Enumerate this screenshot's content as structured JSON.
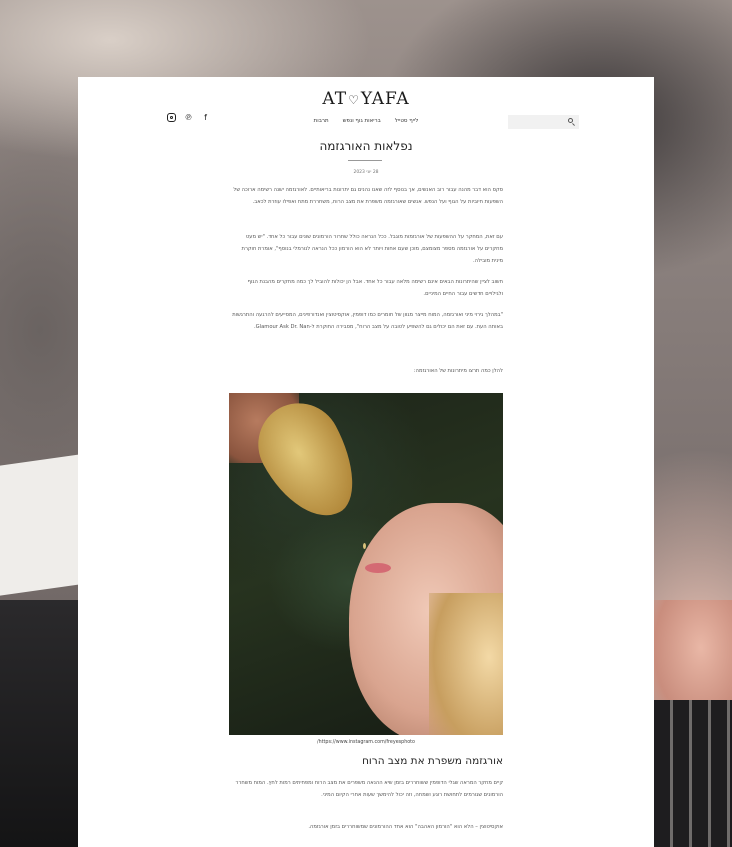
{
  "site": {
    "logo_left": "AT",
    "logo_right": "YAFA",
    "logo_heart": "♡"
  },
  "nav": {
    "items": [
      "לייף סטייל",
      "בריאות גוף ונפש",
      "תרבות"
    ]
  },
  "search": {
    "placeholder": ""
  },
  "social": {
    "instagram": "instagram-icon",
    "pinterest": "pinterest-icon",
    "facebook": "facebook-icon"
  },
  "article": {
    "title": "נפלאות האורגזמה",
    "date": "28 יוני 2023",
    "paragraphs": [
      "סקס הוא דבר מהנה עבור רוב האנשים, אך בנוסף לזה שאנו נהנים גם יתרונות בריאותיים. לאורגזמה ישנה רשימה ארוכה של השפעות חיוביות על הגוף ועל הנפש. אנשים שאורגזמה משפרת את מצב הרוח, משחררת מתח ואפילו עוזרת לכאב.",
      "עם זאת, המחקר על ההשפעות של אורגזמות מוגבל. ככל הנראה כולל שחרור הורמונים שונים עבור כל אחד. \"יש מעט מחקרים על אורגזמה מספר מצומצם, מוכן שעם אחות ויותר לא הוא הורמון ככל הנראה לנורמלי בנוסף\", אומרת חוקרת מינית מובילה.",
      "חשוב לציין שהיתרונות הבאים אינם רשימה מלאה עבור כל אחד. אבל הן יכולות להוביל לך כמה מחקרים מהבנת הגוף ולגילויים חדשים עבור החיים המיניים.",
      "\"במהלך גירוי מיני ואורגזמה, המוח מייצר מגוון של חומרים כמו דופמין, אוקסיטוצין ואנדורפינים, המסייעים להרגעה והתרגשות באותה העת. עם זאת הם יכולים גם להשפיע לטובה על מצב הרוח\", מסבירה החוקרת ל-Glamour Ask Dr. Nan.",
      "להלן כמה תרצו מיתרונות של האורגזמה:"
    ],
    "photo_caption": "/https://www.instagram.com/freyesphoto",
    "subheading": "אורגזמה משפרת את מצב הרוח",
    "paragraphs_after": [
      "קיים מחקר המראה שגלי הדופמין ששוחררים בזמן שיא ההנאה משפרים את מצב הרוח ומפחיתים רמות לחץ. המוח משחרר הורמונים שגורמים לתחושת רוגע ושמחה, וזה יכול להימשך שעות אחרי הקיום המיני.",
      "אוקסיטוצין – הלא הוא \"הורמון האהבה\" הוא אחד ההורמונים שמשוחררים בזמן אורגזמה."
    ]
  }
}
